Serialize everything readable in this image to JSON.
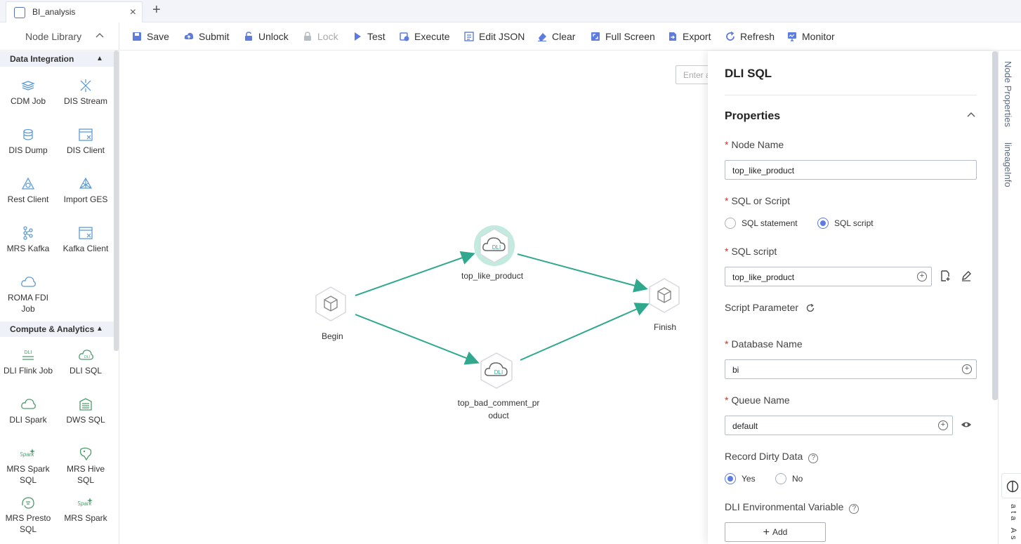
{
  "tab": {
    "title": "BI_analysis",
    "close": "×",
    "add": "+"
  },
  "library": {
    "title": "Node Library",
    "collapse": "^",
    "categories": [
      {
        "label": "Data Integration",
        "arrow": "▲"
      },
      {
        "label": "Compute & Analytics",
        "arrow": "▲"
      }
    ],
    "items": [
      "CDM Job",
      "DIS Stream",
      "DIS Dump",
      "DIS Client",
      "Rest Client",
      "Import GES",
      "MRS Kafka",
      "Kafka Client",
      "ROMA FDI Job",
      "DLI Flink Job",
      "DLI SQL",
      "DLI Spark",
      "DWS SQL",
      "MRS Spark SQL",
      "MRS Hive SQL",
      "MRS Presto SQL",
      "MRS Spark"
    ],
    "item_icons": [
      "layers-icon",
      "dis-stream-icon",
      "database-icon",
      "window-icon",
      "triangle-node-icon",
      "graph-icon",
      "kafka-icon",
      "window-icon",
      "cloud-icon",
      "dli-icon",
      "dli-cloud-icon",
      "cloud-icon",
      "dws-icon",
      "spark-icon",
      "hive-icon",
      "presto-icon",
      "spark-icon"
    ],
    "icon_color": "#5b9bd5",
    "icon_color_green": "#4a9d6b"
  },
  "toolbar": [
    "Save",
    "Submit",
    "Unlock",
    "Lock",
    "Test",
    "Execute",
    "Edit JSON",
    "Clear",
    "Full Screen",
    "Export",
    "Refresh",
    "Monitor"
  ],
  "toolbar_icons": [
    "save-icon",
    "upload-icon",
    "unlock-icon",
    "lock-icon",
    "play-icon",
    "execute-icon",
    "edit-json-icon",
    "eraser-icon",
    "fullscreen-icon",
    "export-icon",
    "refresh-icon",
    "monitor-icon"
  ],
  "accent": "#5e7ce0",
  "edge_color": "#2fa88e",
  "canvas": {
    "search_placeholder": "Enter a",
    "nodes": [
      {
        "label": "Begin",
        "type": "start"
      },
      {
        "label": "top_like_product",
        "type": "dli",
        "selected": true
      },
      {
        "label": "top_bad_comment_pr\noduct",
        "type": "dli"
      },
      {
        "label": "Finish",
        "type": "end"
      }
    ],
    "dli_badge": "DLI"
  },
  "props": {
    "title": "DLI SQL",
    "section": "Properties",
    "node_name_label": "Node Name",
    "node_name": "top_like_product",
    "sql_or_script_label": "SQL or Script",
    "opt_statement": "SQL statement",
    "opt_script": "SQL script",
    "sql_script_label": "SQL script",
    "sql_script": "top_like_product",
    "script_param_label": "Script Parameter",
    "db_label": "Database Name",
    "db": "bi",
    "queue_label": "Queue Name",
    "queue": "default",
    "dirty_label": "Record Dirty Data",
    "yes": "Yes",
    "no": "No",
    "env_label": "DLI Environmental Variable",
    "add": "Add",
    "help": "?"
  },
  "right_tabs": [
    "Node Properties",
    "lineageInfo"
  ],
  "right_vertical_text": "ata As"
}
